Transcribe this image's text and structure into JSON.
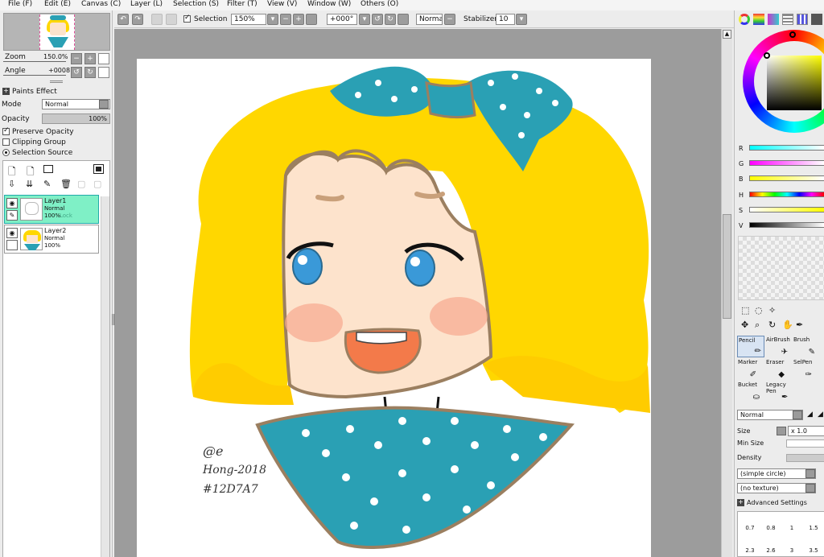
{
  "menu": [
    "File (F)",
    "Edit (E)",
    "Canvas (C)",
    "Layer (L)",
    "Selection (S)",
    "Filter (T)",
    "View (V)",
    "Window (W)",
    "Others (O)"
  ],
  "toolbar": {
    "selection_label": "Selection",
    "zoom_value": "150%",
    "angle_value": "+000°",
    "blend_mode": "Normal",
    "stabilizer_label": "Stabilizer",
    "stabilizer_value": "10"
  },
  "navigator": {
    "zoom_label": "Zoom",
    "zoom_value": "150.0%",
    "angle_label": "Angle",
    "angle_value": "+0008"
  },
  "paints_effect": {
    "header": "Paints Effect",
    "mode_label": "Mode",
    "mode_value": "Normal",
    "opacity_label": "Opacity",
    "opacity_value": "100%"
  },
  "layer_options": {
    "preserve_opacity": "Preserve Opacity",
    "preserve_opacity_checked": true,
    "clipping_group": "Clipping Group",
    "clipping_group_checked": false,
    "selection_source": "Selection Source"
  },
  "layers": [
    {
      "name": "Layer1",
      "mode": "Normal",
      "opacity": "100%",
      "lock": "Lock",
      "selected": true
    },
    {
      "name": "Layer2",
      "mode": "Normal",
      "opacity": "100%",
      "lock": "",
      "selected": false
    }
  ],
  "color_sliders": [
    "R",
    "G",
    "B",
    "H",
    "S",
    "V"
  ],
  "tools": {
    "row1": [
      "Pencil",
      "AirBrush",
      "Brush"
    ],
    "row2": [
      "Marker",
      "Eraser",
      "SelPen"
    ],
    "row3": [
      "Bucket",
      "Legacy Pen"
    ]
  },
  "brush": {
    "blend_mode": "Normal",
    "size_label": "Size",
    "size_multiplier": "x 1.0",
    "min_size_label": "Min Size",
    "density_label": "Density",
    "shape": "(simple circle)",
    "texture": "(no texture)",
    "advanced_label": "Advanced Settings",
    "sizes_row1": [
      "0.7",
      "0.8",
      "1",
      "1.5"
    ],
    "sizes_row2": [
      "2.3",
      "2.6",
      "3",
      "3.5"
    ]
  },
  "artwork": {
    "signature_line1": "@e",
    "signature_line2": "Hong-2018",
    "signature_line3": "#12D7A7"
  },
  "colors": {
    "hair": "#ffd700",
    "dress": "#2aa0b4",
    "skin": "#fde3cc",
    "outline": "#9b7f60",
    "selected_layer": "#7ff0c6"
  }
}
